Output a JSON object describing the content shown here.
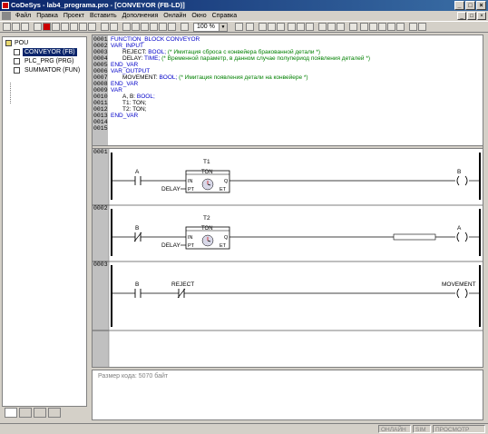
{
  "window": {
    "title": "CoDeSys - lab4_programa.pro - [CONVEYOR (FB-LD)]",
    "controls": [
      "_",
      "□",
      "×"
    ]
  },
  "menu": [
    "Файл",
    "Правка",
    "Проект",
    "Вставить",
    "Дополнения",
    "Онлайн",
    "Окно",
    "Справка"
  ],
  "toolbar": {
    "zoom": "100 %"
  },
  "tree": {
    "root": "POU",
    "items": [
      {
        "label": "CONVEYOR (FB)",
        "selected": true
      },
      {
        "label": "PLC_PRG (PRG)",
        "selected": false
      },
      {
        "label": "SUMMATOR (FUN)",
        "selected": false
      }
    ]
  },
  "declaration": {
    "lines": [
      "0001",
      "0002",
      "0003",
      "0004",
      "0005",
      "0006",
      "0007",
      "0008",
      "0009",
      "0010",
      "0011",
      "0012",
      "0013",
      "0014",
      "0015"
    ],
    "code": {
      "l1": "FUNCTION_BLOCK CONVEYOR",
      "l2": "VAR_INPUT",
      "l3_name": "REJECT:",
      "l3_type": "BOOL;",
      "l3_comment": "(* Имитация сброса с конвейера бракованной детали *)",
      "l4_name": "DELAY:",
      "l4_type": "TIME;",
      "l4_comment": "(* Временной параметр, в данном случае полупериод появления деталей *)",
      "l5": "END_VAR",
      "l6": "VAR_OUTPUT",
      "l7_name": "MOVEMENT:",
      "l7_type": "BOOL;",
      "l7_comment": "(* Имитация появления детали на конвейере *)",
      "l8": "END_VAR",
      "l9": "VAR",
      "l10_name": "A, B:",
      "l10_type": "BOOL;",
      "l11": "T1: TON;",
      "l12": "T2: TON;",
      "l13": "END_VAR"
    }
  },
  "ladder": {
    "networks": [
      {
        "num": "0001",
        "contact": "A",
        "timer_name": "T1",
        "timer_type": "TON",
        "pt_input": "DELAY",
        "pin_in": "IN",
        "pin_pt": "PT",
        "pin_q": "Q",
        "pin_et": "ET",
        "coil": "B"
      },
      {
        "num": "0002",
        "contact": "B",
        "timer_name": "T2",
        "timer_type": "TON",
        "pt_input": "DELAY",
        "pin_in": "IN",
        "pin_pt": "PT",
        "pin_q": "Q",
        "pin_et": "ET",
        "coil": "A"
      },
      {
        "num": "0003",
        "contact1": "B",
        "contact2": "REJECT",
        "coil": "MOVEMENT"
      }
    ]
  },
  "messages": {
    "text": "Размер кода: 5070 байт"
  },
  "status": [
    "ОНЛАЙН",
    "SIM",
    "ПРОСМОТР"
  ]
}
